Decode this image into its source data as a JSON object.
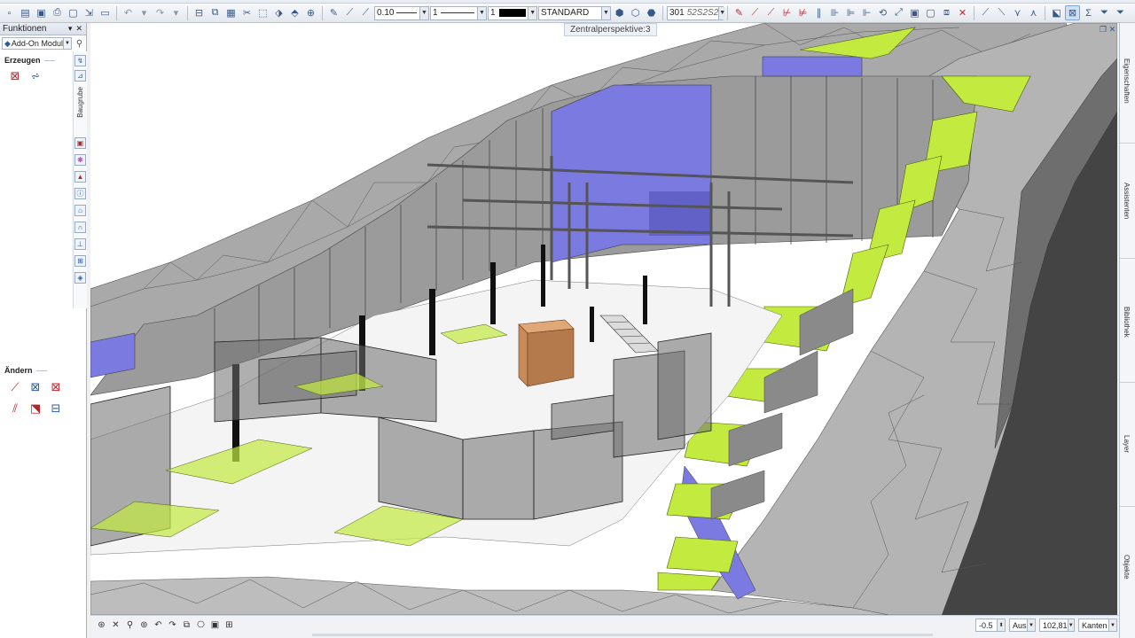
{
  "toolbar": {
    "pen_thickness": "0.10",
    "line_type": "1",
    "line_color": "1",
    "format_style": "STANDARD",
    "layer_code": "301",
    "layer_pattern": "52S2S2"
  },
  "left_panel": {
    "title": "Funktionen",
    "module_select": "Add-On Modul",
    "section_create": "Erzeugen",
    "section_modify": "Ändern",
    "vertical_tab": "Baugrube"
  },
  "viewport": {
    "title": "Zentralperspektive:3"
  },
  "right_dock": {
    "tabs": [
      "Eigenschaften",
      "Assistenten",
      "Bibliothek",
      "Layer",
      "Objekte"
    ]
  },
  "statusbar": {
    "angle": "-0.5",
    "mode": "Aus",
    "zoom": "102,81",
    "display": "Kanten"
  },
  "colors": {
    "terrain": "#a6a6a6",
    "terrain_light": "#c2c2c2",
    "glass": "#7a7a7a",
    "accent_green": "#c3ea3f",
    "accent_blue": "#7a7ae0",
    "wood": "#c98a5a"
  }
}
